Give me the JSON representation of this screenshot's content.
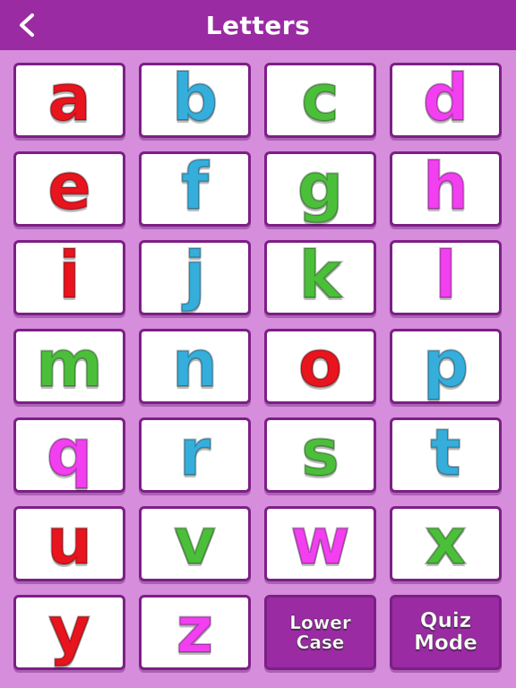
{
  "header": {
    "title": "Letters",
    "back_icon": "chevron-left-icon"
  },
  "colors": {
    "background": "#d58ddc",
    "header": "#9a2ba3",
    "tile_border": "#7d1f86",
    "red": "#e8141e",
    "blue": "#35aedc",
    "green": "#4bbf3a",
    "magenta": "#f23ff0"
  },
  "letters": [
    {
      "char": "a",
      "color": "#e8141e"
    },
    {
      "char": "b",
      "color": "#35aedc"
    },
    {
      "char": "c",
      "color": "#4bbf3a"
    },
    {
      "char": "d",
      "color": "#f23ff0"
    },
    {
      "char": "e",
      "color": "#e8141e"
    },
    {
      "char": "f",
      "color": "#35aedc"
    },
    {
      "char": "g",
      "color": "#4bbf3a"
    },
    {
      "char": "h",
      "color": "#f23ff0"
    },
    {
      "char": "i",
      "color": "#e8141e"
    },
    {
      "char": "j",
      "color": "#35aedc"
    },
    {
      "char": "k",
      "color": "#4bbf3a"
    },
    {
      "char": "l",
      "color": "#f23ff0"
    },
    {
      "char": "m",
      "color": "#4bbf3a"
    },
    {
      "char": "n",
      "color": "#35aedc"
    },
    {
      "char": "o",
      "color": "#e8141e"
    },
    {
      "char": "p",
      "color": "#35aedc"
    },
    {
      "char": "q",
      "color": "#f23ff0"
    },
    {
      "char": "r",
      "color": "#35aedc"
    },
    {
      "char": "s",
      "color": "#4bbf3a"
    },
    {
      "char": "t",
      "color": "#35aedc"
    },
    {
      "char": "u",
      "color": "#e8141e"
    },
    {
      "char": "v",
      "color": "#4bbf3a"
    },
    {
      "char": "w",
      "color": "#f23ff0"
    },
    {
      "char": "x",
      "color": "#4bbf3a"
    },
    {
      "char": "y",
      "color": "#e8141e"
    },
    {
      "char": "z",
      "color": "#f23ff0"
    }
  ],
  "buttons": {
    "lower_case": {
      "line1": "Lower",
      "line2": "Case"
    },
    "quiz_mode": {
      "line1": "Quiz",
      "line2": "Mode"
    }
  }
}
